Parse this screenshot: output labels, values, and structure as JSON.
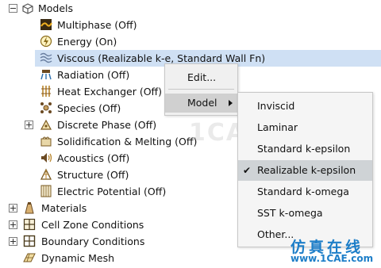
{
  "tree": {
    "models_label": "Models",
    "items": [
      {
        "label": "Multiphase (Off)",
        "icon": "multiphase-icon"
      },
      {
        "label": "Energy (On)",
        "icon": "energy-icon"
      },
      {
        "label": "Viscous (Realizable k-e, Standard Wall Fn)",
        "icon": "viscous-icon"
      },
      {
        "label": "Radiation (Off)",
        "icon": "radiation-icon"
      },
      {
        "label": "Heat Exchanger (Off)",
        "icon": "heat-exchanger-icon"
      },
      {
        "label": "Species (Off)",
        "icon": "species-icon"
      },
      {
        "label": "Discrete Phase (Off)",
        "icon": "discrete-phase-icon"
      },
      {
        "label": "Solidification & Melting (Off)",
        "icon": "solidification-icon"
      },
      {
        "label": "Acoustics (Off)",
        "icon": "acoustics-icon"
      },
      {
        "label": "Structure (Off)",
        "icon": "structure-icon"
      },
      {
        "label": "Electric Potential (Off)",
        "icon": "electric-potential-icon"
      }
    ],
    "root_items": [
      {
        "label": "Materials",
        "icon": "materials-icon"
      },
      {
        "label": "Cell Zone Conditions",
        "icon": "cell-zone-icon"
      },
      {
        "label": "Boundary Conditions",
        "icon": "boundary-conditions-icon"
      },
      {
        "label": "Dynamic Mesh",
        "icon": "dynamic-mesh-icon"
      }
    ]
  },
  "context_menu": {
    "edit_label": "Edit...",
    "model_label": "Model"
  },
  "submenu": {
    "items": [
      "Inviscid",
      "Laminar",
      "Standard k-epsilon",
      "Realizable k-epsilon",
      "Standard k-omega",
      "SST k-omega",
      "Other..."
    ],
    "checked": "Realizable k-epsilon"
  },
  "watermark": {
    "chinese": "仿真在线",
    "url": "www.1CAE.com",
    "background": "1CAE.COM"
  },
  "colors": {
    "selection": "#cfe0f4",
    "watermark": "#1d7ec8"
  }
}
